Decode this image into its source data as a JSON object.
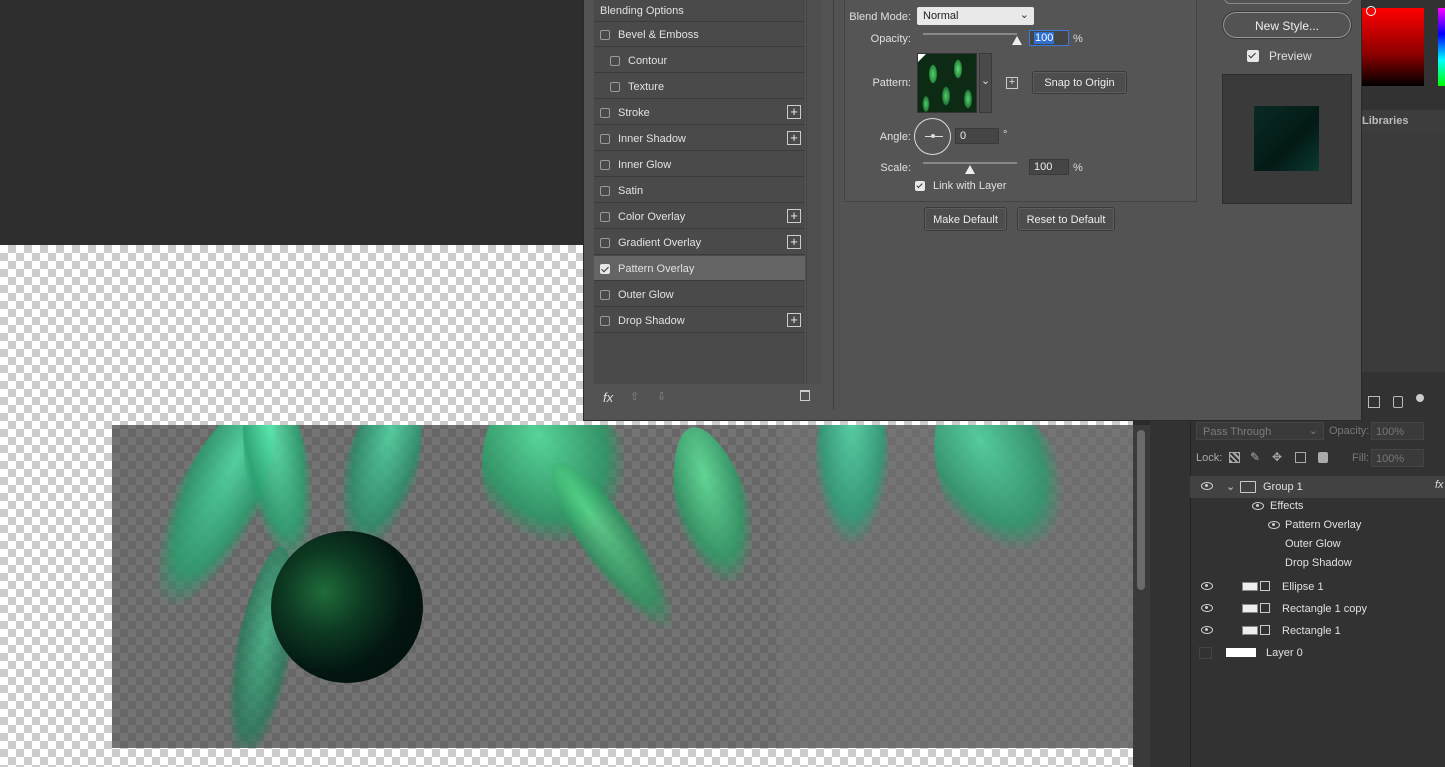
{
  "dialog": {
    "styles": [
      {
        "label": "Blending Options",
        "checkbox": false,
        "plus": false,
        "indent": false,
        "header": true
      },
      {
        "label": "Bevel & Emboss",
        "checkbox": true,
        "checked": false,
        "plus": false,
        "indent": false
      },
      {
        "label": "Contour",
        "checkbox": true,
        "checked": false,
        "plus": false,
        "indent": true
      },
      {
        "label": "Texture",
        "checkbox": true,
        "checked": false,
        "plus": false,
        "indent": true
      },
      {
        "label": "Stroke",
        "checkbox": true,
        "checked": false,
        "plus": true,
        "indent": false
      },
      {
        "label": "Inner Shadow",
        "checkbox": true,
        "checked": false,
        "plus": true,
        "indent": false
      },
      {
        "label": "Inner Glow",
        "checkbox": true,
        "checked": false,
        "plus": false,
        "indent": false
      },
      {
        "label": "Satin",
        "checkbox": true,
        "checked": false,
        "plus": false,
        "indent": false
      },
      {
        "label": "Color Overlay",
        "checkbox": true,
        "checked": false,
        "plus": true,
        "indent": false
      },
      {
        "label": "Gradient Overlay",
        "checkbox": true,
        "checked": false,
        "plus": true,
        "indent": false
      },
      {
        "label": "Pattern Overlay",
        "checkbox": true,
        "checked": true,
        "plus": false,
        "indent": false,
        "selected": true
      },
      {
        "label": "Outer Glow",
        "checkbox": true,
        "checked": false,
        "plus": false,
        "indent": false
      },
      {
        "label": "Drop Shadow",
        "checkbox": true,
        "checked": false,
        "plus": true,
        "indent": false
      }
    ],
    "footer": {
      "fx": "fx",
      "up_icon": "arrow-up-icon",
      "down_icon": "arrow-down-icon",
      "trash_icon": "trash-icon"
    },
    "pattern_overlay": {
      "blend_mode_label": "Blend Mode:",
      "blend_mode_value": "Normal",
      "opacity_label": "Opacity:",
      "opacity_value": "100",
      "percent": "%",
      "pattern_label": "Pattern:",
      "snap_button": "Snap to Origin",
      "angle_label": "Angle:",
      "angle_value": "0",
      "degree": "°",
      "scale_label": "Scale:",
      "scale_value": "100",
      "link_label": "Link with Layer",
      "link_checked": true,
      "make_default": "Make Default",
      "reset_default": "Reset to Default"
    },
    "right": {
      "new_style": "New Style...",
      "preview_label": "Preview",
      "preview_checked": true
    }
  },
  "panels": {
    "libraries_tab": "Libraries",
    "blend_mode": "Pass Through",
    "opacity_label": "Opacity:",
    "opacity_value": "100%",
    "lock_label": "Lock:",
    "fill_label": "Fill:",
    "fill_value": "100%",
    "layers": [
      {
        "name": "Group 1",
        "visible": true,
        "type": "group",
        "fx": "fx"
      },
      {
        "name": "Effects",
        "visible": true,
        "type": "effects"
      },
      {
        "name": "Pattern Overlay",
        "visible": true,
        "type": "effect"
      },
      {
        "name": "Outer Glow",
        "visible": false,
        "type": "effect"
      },
      {
        "name": "Drop Shadow",
        "visible": false,
        "type": "effect"
      },
      {
        "name": "Ellipse 1",
        "visible": true,
        "type": "shape"
      },
      {
        "name": "Rectangle 1 copy",
        "visible": true,
        "type": "shape"
      },
      {
        "name": "Rectangle 1",
        "visible": true,
        "type": "shape"
      },
      {
        "name": "Layer 0",
        "visible": false,
        "type": "pixel"
      }
    ]
  }
}
